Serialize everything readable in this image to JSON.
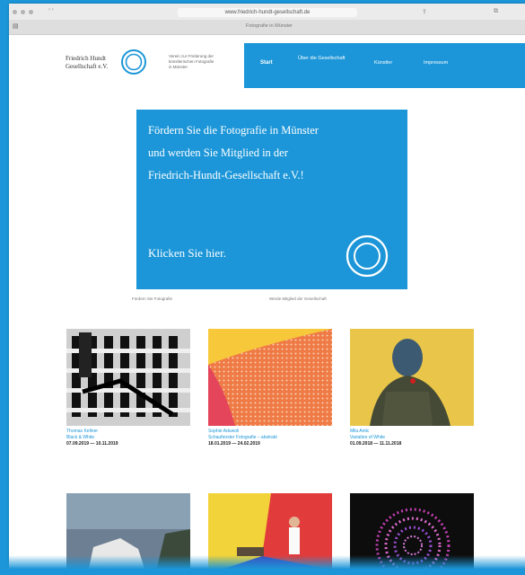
{
  "browser": {
    "url": "www.friedrich-hundt-gesellschaft.de",
    "tab_title": "Fotografie in Münster",
    "nav_glyphs": "‹ ›"
  },
  "header": {
    "brand_line1": "Friedrich Hundt",
    "brand_line2": "Gesellschaft e.V.",
    "tagline_line1": "Verein zur Förderung der",
    "tagline_line2": "künstlerischen Fotografie",
    "tagline_line3": "in Münster",
    "nav": [
      {
        "label": "Start"
      },
      {
        "label": "Über die Gesellschaft"
      },
      {
        "label": "Künstler"
      },
      {
        "label": "Impressum"
      }
    ]
  },
  "promo": {
    "line1": "Fördern Sie die Fotografie in Münster",
    "line2": "und werden Sie Mitglied in der",
    "line3": "Friedrich-Hundt-Gesellschaft e.V.!",
    "cta": "Klicken Sie hier.",
    "caption_left": "Fördern Sie Fotografie",
    "caption_right": "Werde Mitglied der Gesellschaft"
  },
  "exhibitions": [
    {
      "artist": "Thomas Kellner",
      "title": "Black & White",
      "dates": "07.09.2019 — 10.11.2019"
    },
    {
      "artist": "Sophie Aduwoli",
      "title": "Schaufenster Fotografie – abstrakt",
      "dates": "18.01.2019 — 24.02.2019"
    },
    {
      "artist": "Mila Antic",
      "title": "Variation of White",
      "dates": "01.09.2018 — 11.11.2018"
    }
  ],
  "colors": {
    "brand_blue": "#1c96d8"
  },
  "icons": [
    "logo-ring-icon",
    "promo-ring-icon"
  ]
}
